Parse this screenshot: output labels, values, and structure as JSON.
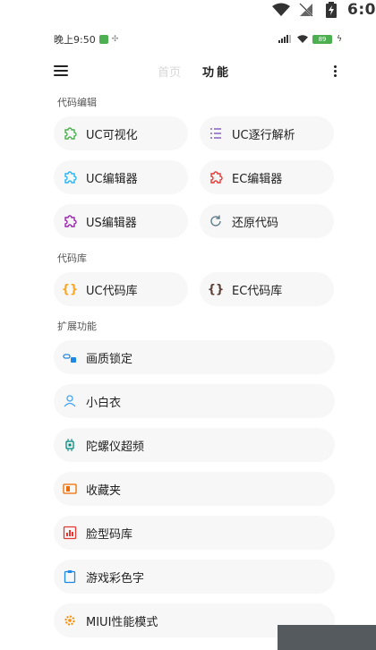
{
  "outer_status": {
    "time": "6:0"
  },
  "inner_status": {
    "time": "晚上9:50",
    "battery": "89"
  },
  "appbar": {
    "tab_home": "首页",
    "tab_func": "功能"
  },
  "sections": [
    {
      "title": "代码编辑",
      "items": [
        {
          "label": "UC可视化",
          "icon": "puzzle-icon",
          "color": "#4caf50"
        },
        {
          "label": "UC逐行解析",
          "icon": "list-icon",
          "color": "#7e57c2"
        },
        {
          "label": "UC编辑器",
          "icon": "puzzle-icon",
          "color": "#29b6f6"
        },
        {
          "label": "EC编辑器",
          "icon": "puzzle-icon",
          "color": "#e53935"
        },
        {
          "label": "US编辑器",
          "icon": "puzzle-icon",
          "color": "#9c27b0"
        },
        {
          "label": "还原代码",
          "icon": "restore-icon",
          "color": "#607d8b"
        }
      ]
    },
    {
      "title": "代码库",
      "items": [
        {
          "label": "UC代码库",
          "icon": "braces-icon",
          "color": "#f9a825"
        },
        {
          "label": "EC代码库",
          "icon": "braces-icon",
          "color": "#5d4037"
        }
      ]
    },
    {
      "title": "扩展功能",
      "items": [
        {
          "label": "画质锁定",
          "icon": "link-lock-icon",
          "color": "#1e88e5"
        },
        {
          "label": "小白衣",
          "icon": "person-icon",
          "color": "#42a5f5"
        },
        {
          "label": "陀螺仪超频",
          "icon": "chip-icon",
          "color": "#00897b"
        },
        {
          "label": "收藏夹",
          "icon": "bookmark-icon",
          "color": "#ef6c00"
        },
        {
          "label": "脸型码库",
          "icon": "chart-icon",
          "color": "#e53935"
        },
        {
          "label": "游戏彩色字",
          "icon": "clipboard-icon",
          "color": "#1e88e5"
        },
        {
          "label": "MIUI性能模式",
          "icon": "gear-icon",
          "color": "#fb8c00"
        }
      ]
    }
  ]
}
